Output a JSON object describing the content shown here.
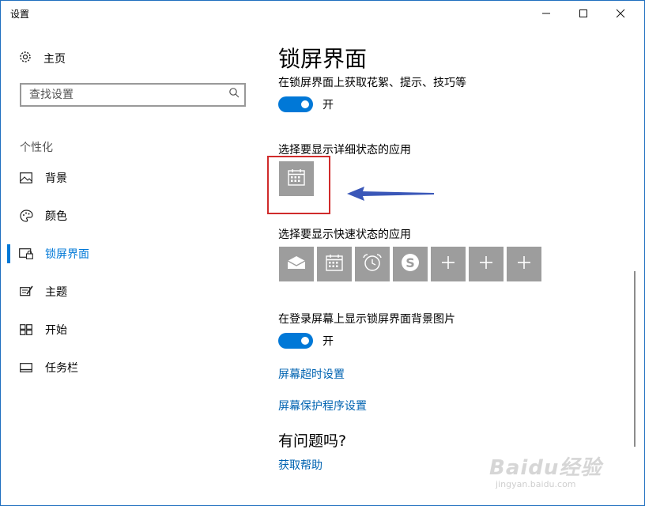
{
  "window": {
    "title": "设置",
    "controls": {
      "minimize": "—",
      "maximize": "☐",
      "close": "✕"
    }
  },
  "sidebar": {
    "home": {
      "label": "主页",
      "icon": "gear-icon"
    },
    "search": {
      "placeholder": "查找设置",
      "icon": "search-icon"
    },
    "section_label": "个性化",
    "items": [
      {
        "label": "背景",
        "icon": "picture-icon"
      },
      {
        "label": "颜色",
        "icon": "palette-icon"
      },
      {
        "label": "锁屏界面",
        "icon": "lock-screen-icon",
        "active": true
      },
      {
        "label": "主题",
        "icon": "theme-icon"
      },
      {
        "label": "开始",
        "icon": "start-icon"
      },
      {
        "label": "任务栏",
        "icon": "taskbar-icon"
      }
    ]
  },
  "main": {
    "title": "锁屏界面",
    "fun_facts": {
      "label": "在锁屏界面上获取花絮、提示、技巧等",
      "state": "开",
      "on": true
    },
    "detailed_status": {
      "label": "选择要显示详细状态的应用",
      "app_icon": "calendar-icon"
    },
    "quick_status": {
      "label": "选择要显示快速状态的应用",
      "app_icons": [
        "mail-icon",
        "calendar-icon",
        "alarm-icon",
        "skype-icon",
        "plus-icon",
        "plus-icon",
        "plus-icon"
      ]
    },
    "signin_background": {
      "label": "在登录屏幕上显示锁屏界面背景图片",
      "state": "开",
      "on": true
    },
    "links": {
      "timeout": "屏幕超时设置",
      "screensaver": "屏幕保护程序设置"
    },
    "help": {
      "title": "有问题吗?",
      "link": "获取帮助"
    }
  },
  "watermark": {
    "logo": "Baidu经验",
    "url": "jingyan.baidu.com"
  },
  "colors": {
    "accent": "#0078d7",
    "link": "#0063b1",
    "tile": "#9d9d9d",
    "highlight": "#d02b2b",
    "arrow": "#3a57b8"
  }
}
